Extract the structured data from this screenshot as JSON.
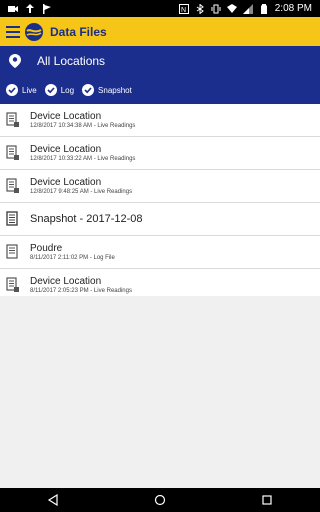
{
  "status_bar": {
    "time": "2:08 PM"
  },
  "app_bar": {
    "title": "Data Files"
  },
  "filters": {
    "location": "All Locations",
    "chips": [
      {
        "label": "Live"
      },
      {
        "label": "Log"
      },
      {
        "label": "Snapshot"
      }
    ]
  },
  "files": [
    {
      "title": "Device Location",
      "subtitle": "12/8/2017 10:34:38 AM - Live Readings"
    },
    {
      "title": "Device Location",
      "subtitle": "12/8/2017 10:33:22 AM - Live Readings"
    },
    {
      "title": "Device Location",
      "subtitle": "12/8/2017 9:48:25 AM - Live Readings"
    },
    {
      "title": "Snapshot - 2017-12-08",
      "subtitle": ""
    },
    {
      "title": "Poudre",
      "subtitle": "8/11/2017 2:11:02 PM - Log File"
    },
    {
      "title": "Device Location",
      "subtitle": "8/11/2017 2:05:23 PM - Live Readings"
    }
  ]
}
